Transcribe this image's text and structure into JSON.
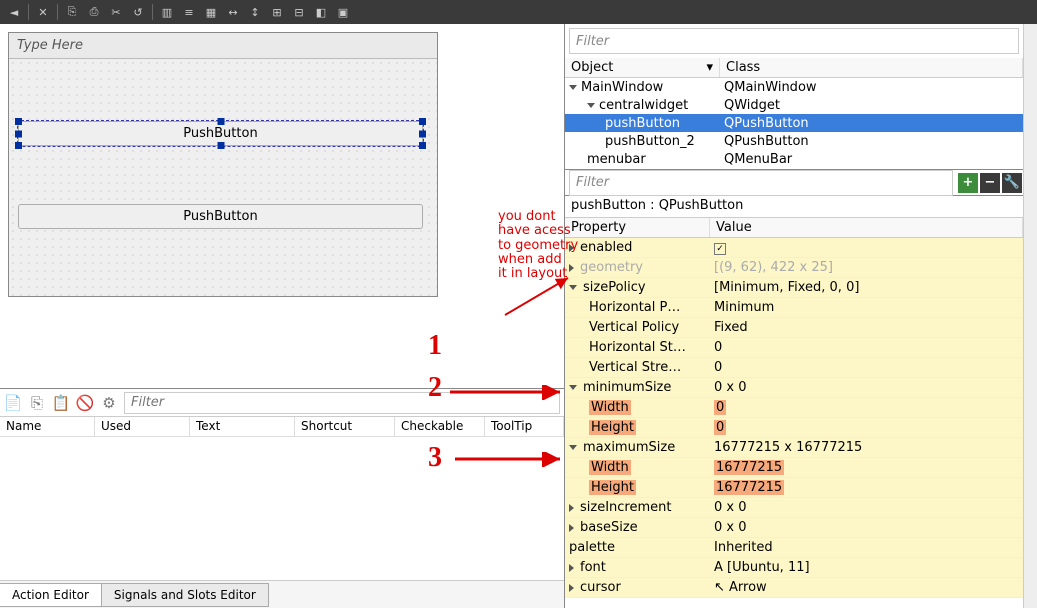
{
  "toolbar_icons": [
    "arrow-icon",
    "close-icon",
    "copy-icon",
    "paste-icon",
    "cut-icon",
    "undo-icon",
    "hlayout-icon",
    "vlayout-icon",
    "grid-icon",
    "form-icon",
    "splitter-h-icon",
    "splitter-v-icon",
    "break-icon",
    "adjust-icon"
  ],
  "form": {
    "menu_placeholder": "Type Here",
    "pb1": "PushButton",
    "pb2": "PushButton"
  },
  "action_editor": {
    "filter_placeholder": "Filter",
    "cols": {
      "name": "Name",
      "used": "Used",
      "text": "Text",
      "shortcut": "Shortcut",
      "checkable": "Checkable",
      "tooltip": "ToolTip"
    },
    "tab1": "Action Editor",
    "tab2": "Signals and Slots Editor"
  },
  "objinspector": {
    "filter_placeholder": "Filter",
    "col_obj": "Object",
    "col_cls": "Class",
    "rows": [
      {
        "indent": 0,
        "obj": "MainWindow",
        "cls": "QMainWindow",
        "expand": true
      },
      {
        "indent": 1,
        "obj": "centralwidget",
        "cls": "QWidget",
        "expand": true
      },
      {
        "indent": 2,
        "obj": "pushButton",
        "cls": "QPushButton",
        "sel": true
      },
      {
        "indent": 2,
        "obj": "pushButton_2",
        "cls": "QPushButton"
      },
      {
        "indent": 1,
        "obj": "menubar",
        "cls": "QMenuBar"
      }
    ]
  },
  "propeditor": {
    "filter_placeholder": "Filter",
    "title": "pushButton : QPushButton",
    "col_prop": "Property",
    "col_val": "Value",
    "rows": [
      {
        "k": "enabled",
        "v": "",
        "ck": true,
        "yellow": true,
        "tri": "closed"
      },
      {
        "k": "geometry",
        "v": "[(9, 62), 422 x 25]",
        "yellow": true,
        "disabled": true,
        "tri": "closed"
      },
      {
        "k": "sizePolicy",
        "v": "[Minimum, Fixed, 0, 0]",
        "yellow": true,
        "tri": "open"
      },
      {
        "k": "Horizontal P…",
        "v": "Minimum",
        "yellow": true,
        "sub": true
      },
      {
        "k": "Vertical Policy",
        "v": "Fixed",
        "yellow": true,
        "sub": true
      },
      {
        "k": "Horizontal St…",
        "v": "0",
        "yellow": true,
        "sub": true
      },
      {
        "k": "Vertical Stre…",
        "v": "0",
        "yellow": true,
        "sub": true
      },
      {
        "k": "minimumSize",
        "v": "0 x 0",
        "yellow": true,
        "tri": "open"
      },
      {
        "k": "Width",
        "v": "0",
        "yellow": true,
        "sub": true,
        "hl": true
      },
      {
        "k": "Height",
        "v": "0",
        "yellow": true,
        "sub": true,
        "hl": true
      },
      {
        "k": "maximumSize",
        "v": "16777215 x 16777215",
        "yellow": true,
        "tri": "open"
      },
      {
        "k": "Width",
        "v": "16777215",
        "yellow": true,
        "sub": true,
        "hl": true
      },
      {
        "k": "Height",
        "v": "16777215",
        "yellow": true,
        "sub": true,
        "hl": true
      },
      {
        "k": "sizeIncrement",
        "v": "0 x 0",
        "yellow": true,
        "tri": "closed"
      },
      {
        "k": "baseSize",
        "v": "0 x 0",
        "yellow": true,
        "tri": "closed"
      },
      {
        "k": "palette",
        "v": "Inherited",
        "yellow": true
      },
      {
        "k": "font",
        "v": "A  [Ubuntu, 11]",
        "yellow": true,
        "tri": "closed"
      },
      {
        "k": "cursor",
        "v": "↖  Arrow",
        "yellow": true,
        "tri": "closed"
      }
    ]
  },
  "annotations": {
    "note": "you dont\nhave acess\nto geometry\nwhen add\nit in layout",
    "n1": "1",
    "n2": "2",
    "n3": "3"
  }
}
